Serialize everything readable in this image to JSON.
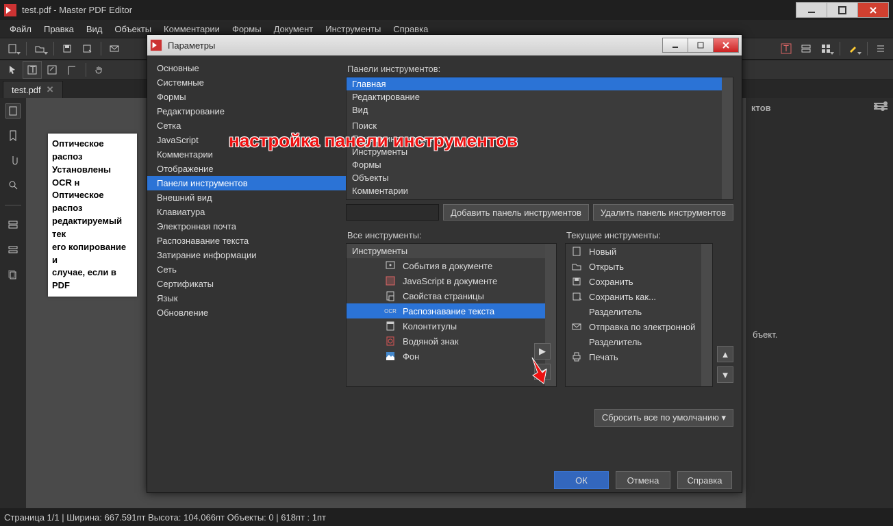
{
  "app_title": "test.pdf - Master PDF Editor",
  "menus": [
    "Файл",
    "Правка",
    "Вид",
    "Объекты",
    "Комментарии",
    "Формы",
    "Документ",
    "Инструменты",
    "Справка"
  ],
  "document_tab": "test.pdf",
  "right_panel_title": "ктов",
  "right_panel_body": "бъект.",
  "page_text": {
    "l1": "Оптическое распоз",
    "l2": "Установлены OCR н",
    "l3": "Оптическое распоз",
    "l4": "редактируемый тек",
    "l5": "его копирование и",
    "l6": "случае, если в PDF"
  },
  "statusbar": "Страница 1/1 |  Ширина: 667.591пт Высота: 104.066пт Объекты: 0   |   618пт : 1пт",
  "annotation": "настройка панели инструментов",
  "dialog": {
    "title": "Параметры",
    "nav": [
      "Основные",
      "Системные",
      "Формы",
      "Редактирование",
      "Сетка",
      "JavaScript",
      "Комментарии",
      "Отображение",
      "Панели инструментов",
      "Внешний вид",
      "Клавиатура",
      "Электронная почта",
      "Распознавание текста",
      "Затирание информации",
      "Сеть",
      "Сертификаты",
      "Язык",
      "Обновление"
    ],
    "nav_selected": "Панели инструментов",
    "toolbars_label": "Панели инструментов:",
    "toolbars": [
      "Главная",
      "Редактирование",
      "Вид",
      " ",
      "Поиск",
      "Панели инструментов",
      "Инструменты",
      "Формы",
      "Объекты",
      "Комментарии"
    ],
    "toolbars_selected": "Главная",
    "add_toolbar": "Добавить панель инструментов",
    "del_toolbar": "Удалить панель инструментов",
    "all_tools_label": "Все инструменты:",
    "all_header": "Инструменты",
    "all_items": [
      {
        "icon": "doc-event",
        "label": "События в документе"
      },
      {
        "icon": "js",
        "label": "JavaScript в документе"
      },
      {
        "icon": "page-props",
        "label": "Свойства страницы"
      },
      {
        "icon": "ocr",
        "label": "Распознавание текста"
      },
      {
        "icon": "header-footer",
        "label": "Колонтитулы"
      },
      {
        "icon": "watermark",
        "label": "Водяной знак"
      },
      {
        "icon": "background",
        "label": "Фон"
      }
    ],
    "all_selected": "Распознавание текста",
    "current_label": "Текущие инструменты:",
    "current_items": [
      {
        "icon": "new",
        "label": "Новый"
      },
      {
        "icon": "open",
        "label": "Открыть"
      },
      {
        "icon": "save",
        "label": "Сохранить"
      },
      {
        "icon": "saveas",
        "label": "Сохранить как..."
      },
      {
        "icon": "sep",
        "label": "Разделитель"
      },
      {
        "icon": "mail",
        "label": "Отправка по электронной"
      },
      {
        "icon": "sep",
        "label": "Разделитель"
      },
      {
        "icon": "print",
        "label": "Печать"
      }
    ],
    "reset": "Сбросить все по умолчанию",
    "ok": "ОК",
    "cancel": "Отмена",
    "help": "Справка"
  }
}
